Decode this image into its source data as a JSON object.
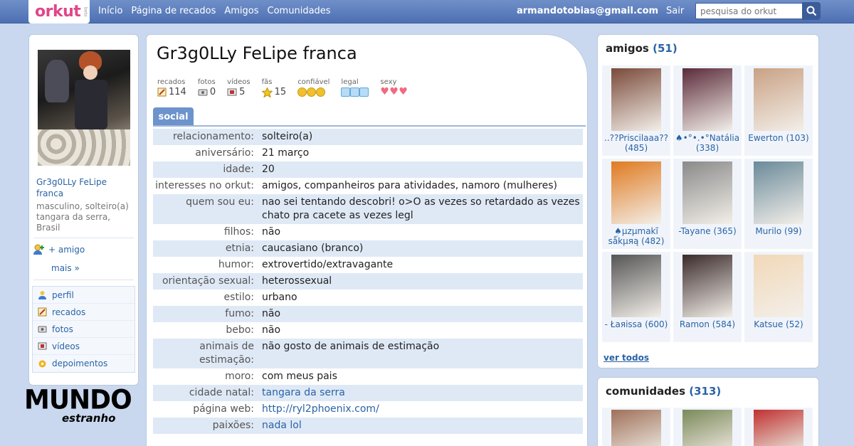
{
  "header": {
    "logo_text": "orkut",
    "logo_badge": "beta",
    "nav": [
      "Início",
      "Página de recados",
      "Amigos",
      "Comunidades"
    ],
    "email": "armandotobias@gmail.com",
    "logout": "Sair",
    "search_placeholder": "pesquisa do orkut"
  },
  "sidebar": {
    "name": "Gr3g0LLy FeLipe franca",
    "info": "masculino, solteiro(a) tangara da serra, Brasil",
    "add_friend": "+ amigo",
    "more": "mais »",
    "menu": [
      {
        "label": "perfil",
        "icon": "profile-icon"
      },
      {
        "label": "recados",
        "icon": "scrap-icon"
      },
      {
        "label": "fotos",
        "icon": "camera-icon"
      },
      {
        "label": "vídeos",
        "icon": "video-icon"
      },
      {
        "label": "depoimentos",
        "icon": "testimonial-icon"
      }
    ]
  },
  "watermark": {
    "line1": "MUNDO",
    "line2": "estranho"
  },
  "profile": {
    "name": "Gr3g0LLy FeLipe franca",
    "stats": [
      {
        "label": "recados",
        "value": "114"
      },
      {
        "label": "fotos",
        "value": "0"
      },
      {
        "label": "vídeos",
        "value": "5"
      },
      {
        "label": "fãs",
        "value": "15"
      }
    ],
    "ratings": [
      {
        "label": "confiável",
        "count": 3
      },
      {
        "label": "legal",
        "count": 3
      },
      {
        "label": "sexy",
        "count": 3
      }
    ],
    "tab": "social",
    "rows": [
      {
        "k": "relacionamento:",
        "v": "solteiro(a)",
        "link": false
      },
      {
        "k": "aniversário:",
        "v": "21 março",
        "link": false
      },
      {
        "k": "idade:",
        "v": "20",
        "link": false
      },
      {
        "k": "interesses no orkut:",
        "v": "amigos, companheiros para atividades, namoro (mulheres)",
        "link": false
      },
      {
        "k": "quem sou eu:",
        "v": "nao sei tentando descobri! o>O as vezes so retardado as vezes chato pra cacete as vezes legl",
        "link": false
      },
      {
        "k": "filhos:",
        "v": "não",
        "link": false
      },
      {
        "k": "etnia:",
        "v": "caucasiano (branco)",
        "link": false
      },
      {
        "k": "humor:",
        "v": "extrovertido/extravagante",
        "link": false
      },
      {
        "k": "orientação sexual:",
        "v": "heterossexual",
        "link": false
      },
      {
        "k": "estilo:",
        "v": "urbano",
        "link": false
      },
      {
        "k": "fumo:",
        "v": "não",
        "link": false
      },
      {
        "k": "bebo:",
        "v": "não",
        "link": false
      },
      {
        "k": "animais de estimação:",
        "v": "não gosto de animais de estimação",
        "link": false
      },
      {
        "k": "moro:",
        "v": "com meus pais",
        "link": false
      },
      {
        "k": "cidade natal:",
        "v": "tangara da serra",
        "link": true
      },
      {
        "k": "página web:",
        "v": "http://ryl2phoenix.com/",
        "link": true
      },
      {
        "k": "paixões:",
        "v": "nada lol",
        "link": true
      }
    ]
  },
  "friends": {
    "title": "amigos",
    "count": "(51)",
    "items": [
      {
        "name": "..??Priscilaaa?? (485)",
        "color": "#7a4a3a"
      },
      {
        "name": "♠•°•.•°Natália (338)",
        "color": "#5b2b3a"
      },
      {
        "name": "Ewerton (103)",
        "color": "#c9a184"
      },
      {
        "name": "♠µzµmakĩ sǻkµяą (482)",
        "color": "#e07a20"
      },
      {
        "name": "-Tayane (365)",
        "color": "#8a8a8a"
      },
      {
        "name": "Murilo (99)",
        "color": "#6a8a9a"
      },
      {
        "name": "- Łaяissa (600)",
        "color": "#555555"
      },
      {
        "name": "Ramon (584)",
        "color": "#3a2a2a"
      },
      {
        "name": "Katsue (52)",
        "color": "#f2d8b8"
      }
    ],
    "see_all": "ver todos"
  },
  "communities": {
    "title": "comunidades",
    "count": "(313)",
    "items": [
      {
        "color": "#a0705a"
      },
      {
        "color": "#7a8a5a"
      },
      {
        "color": "#c03030"
      }
    ]
  }
}
